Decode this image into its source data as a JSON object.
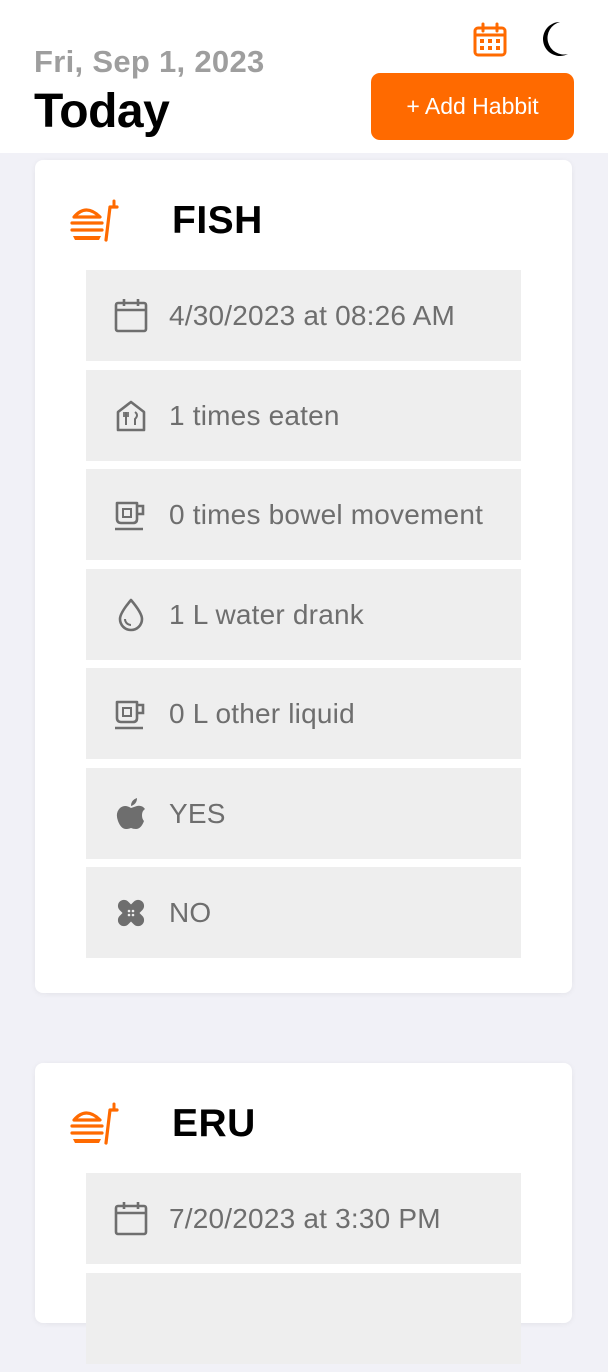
{
  "header": {
    "date": "Fri, Sep 1, 2023",
    "title": "Today",
    "add_button_label": "+ Add Habbit"
  },
  "colors": {
    "accent": "#ff6a00",
    "row_bg": "#eeeeee",
    "row_text": "#6e6e6e",
    "page_bg": "#f1f1f7"
  },
  "icons": {
    "calendar": "calendar-icon",
    "theme": "moon-icon",
    "meal": "burger-drink-icon"
  },
  "cards": [
    {
      "title": "FISH",
      "rows": [
        {
          "icon": "calendar-icon",
          "text": "4/30/2023 at 08:26 AM"
        },
        {
          "icon": "restaurant-icon",
          "text": "1 times eaten"
        },
        {
          "icon": "toilet-icon",
          "text": "0 times bowel movement"
        },
        {
          "icon": "water-drop-icon",
          "text": "1 L water drank"
        },
        {
          "icon": "cup-icon",
          "text": "0 L other liquid"
        },
        {
          "icon": "apple-icon",
          "text": "YES"
        },
        {
          "icon": "bandage-icon",
          "text": "NO"
        }
      ]
    },
    {
      "title": "ERU",
      "rows": [
        {
          "icon": "calendar-icon",
          "text": "7/20/2023 at 3:30 PM"
        }
      ]
    }
  ]
}
